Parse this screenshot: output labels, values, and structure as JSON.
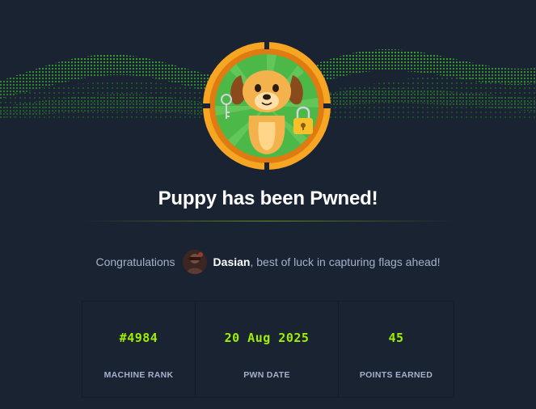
{
  "banner": {
    "accent_color": "#9fef00"
  },
  "badge": {
    "icon": "puppy-machine-badge"
  },
  "header": {
    "title": "Puppy has been Pwned!"
  },
  "congrats": {
    "prefix": "Congratulations",
    "username": "Dasian",
    "suffix": ", best of luck in capturing flags ahead!"
  },
  "stats": [
    {
      "value": "#4984",
      "label": "MACHINE RANK"
    },
    {
      "value": "20 Aug 2025",
      "label": "PWN DATE"
    },
    {
      "value": "45",
      "label": "POINTS EARNED"
    }
  ],
  "colors": {
    "background": "#1a2332",
    "accent": "#9fef00",
    "muted_text": "#a4b1cd",
    "badge_ring": "#f6a623"
  }
}
